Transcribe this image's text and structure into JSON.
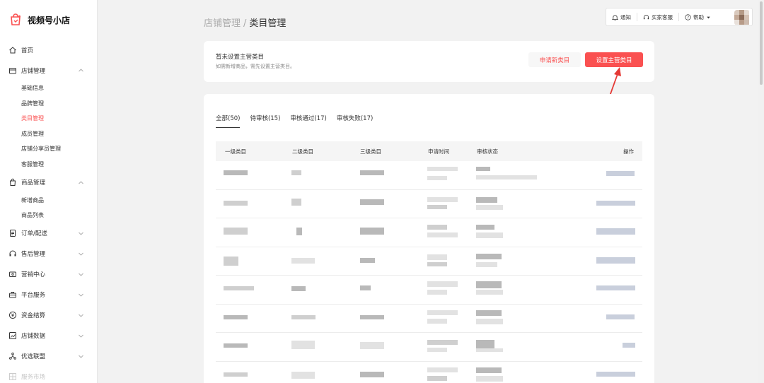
{
  "app": {
    "name": "视频号小店"
  },
  "sidebar": {
    "items": [
      {
        "label": "首页",
        "icon": "home-icon"
      },
      {
        "label": "店铺管理",
        "icon": "shop-icon",
        "expanded": true,
        "children": [
          "基础信息",
          "品牌管理",
          "类目管理",
          "成员管理",
          "店铺分享员管理",
          "客服管理"
        ],
        "active_child": 2
      },
      {
        "label": "商品管理",
        "icon": "bag-icon",
        "expanded": true,
        "children": [
          "新增商品",
          "商品列表"
        ]
      },
      {
        "label": "订单/配送",
        "icon": "order-icon"
      },
      {
        "label": "售后管理",
        "icon": "headset-icon"
      },
      {
        "label": "营销中心",
        "icon": "ticket-icon"
      },
      {
        "label": "平台服务",
        "icon": "briefcase-icon"
      },
      {
        "label": "资金结算",
        "icon": "yen-icon"
      },
      {
        "label": "店铺数据",
        "icon": "chart-icon"
      },
      {
        "label": "优选联盟",
        "icon": "network-icon"
      },
      {
        "label": "服务市场",
        "icon": "grid-icon"
      }
    ]
  },
  "breadcrumb": {
    "parent": "店铺管理",
    "separator": "/",
    "current": "类目管理"
  },
  "topbar": {
    "notify": "通知",
    "customer_service": "买家客服",
    "help": "帮助"
  },
  "notice": {
    "title": "暂未设置主营类目",
    "subtitle": "如需新增商品，需先设置主营类目。",
    "apply_button": "申请新类目",
    "set_button": "设置主营类目"
  },
  "tabs": [
    {
      "label": "全部(50)",
      "active": true
    },
    {
      "label": "待审核(15)"
    },
    {
      "label": "审核通过(17)"
    },
    {
      "label": "审核失败(17)"
    }
  ],
  "table": {
    "columns": [
      "一级类目",
      "二级类目",
      "三级类目",
      "申请时间",
      "审核状态",
      "操作"
    ],
    "row_count": 8,
    "rows_blurred": true
  },
  "colors": {
    "accent": "#fa5151",
    "annotation": "#e53935"
  }
}
